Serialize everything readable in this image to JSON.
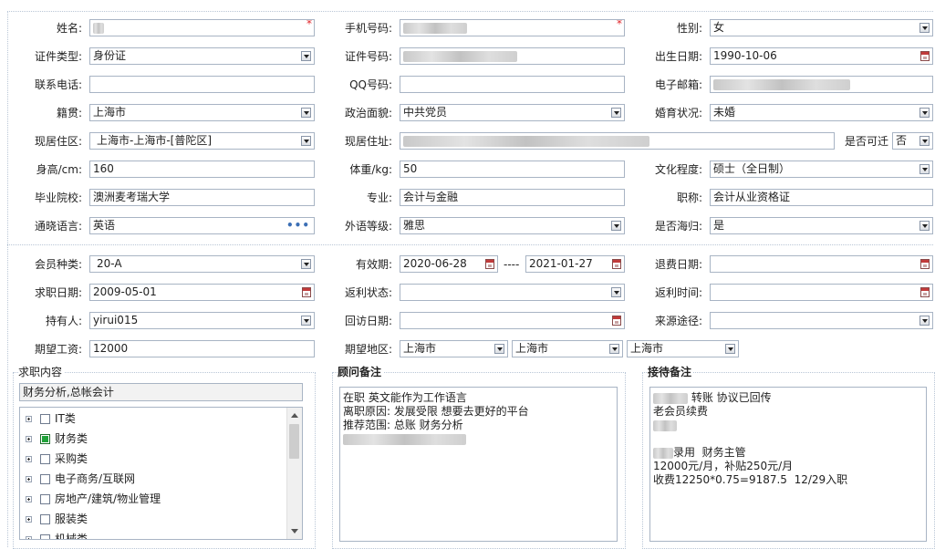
{
  "fields": {
    "name": {
      "label": "姓名:",
      "value": ""
    },
    "mobile": {
      "label": "手机号码:",
      "value": ""
    },
    "gender": {
      "label": "性别:",
      "value": "女"
    },
    "id_type": {
      "label": "证件类型:",
      "value": "身份证"
    },
    "id_number": {
      "label": "证件号码:",
      "value": ""
    },
    "birth_date": {
      "label": "出生日期:",
      "value": "1990-10-06"
    },
    "phone": {
      "label": "联系电话:",
      "value": ""
    },
    "qq": {
      "label": "QQ号码:",
      "value": ""
    },
    "email": {
      "label": "电子邮箱:",
      "value": ""
    },
    "native_place": {
      "label": "籍贯:",
      "value": "上海市"
    },
    "political": {
      "label": "政治面貌:",
      "value": "中共党员"
    },
    "marital": {
      "label": "婚育状况:",
      "value": "未婚"
    },
    "residence_area": {
      "label": "现居住区:",
      "value": "上海市-上海市-[普陀区]"
    },
    "address": {
      "label": "现居住址:",
      "value": ""
    },
    "relocate": {
      "label": "是否可迁",
      "value": "否"
    },
    "height": {
      "label": "身高/cm:",
      "value": "160"
    },
    "weight": {
      "label": "体重/kg:",
      "value": "50"
    },
    "education": {
      "label": "文化程度:",
      "value": "硕士（全日制）"
    },
    "school": {
      "label": "毕业院校:",
      "value": "澳洲麦考瑞大学"
    },
    "major": {
      "label": "专业:",
      "value": "会计与金融"
    },
    "title": {
      "label": "职称:",
      "value": "会计从业资格证"
    },
    "language": {
      "label": "通晓语言:",
      "value": "英语"
    },
    "language_level": {
      "label": "外语等级:",
      "value": "雅思"
    },
    "overseas": {
      "label": "是否海归:",
      "value": "是"
    }
  },
  "membership": {
    "type": {
      "label": "会员种类:",
      "value": "20-A"
    },
    "valid": {
      "label": "有效期:",
      "from": "2020-06-28",
      "sep": "----",
      "to": "2021-01-27"
    },
    "refund_date": {
      "label": "退费日期:",
      "value": ""
    },
    "job_date": {
      "label": "求职日期:",
      "value": "2009-05-01"
    },
    "rebate_status": {
      "label": "返利状态:",
      "value": ""
    },
    "rebate_time": {
      "label": "返利时间:",
      "value": ""
    },
    "holder": {
      "label": "持有人:",
      "value": "yirui015"
    },
    "visit_date": {
      "label": "回访日期:",
      "value": ""
    },
    "source": {
      "label": "来源途径:",
      "value": ""
    },
    "salary": {
      "label": "期望工资:",
      "value": "12000"
    },
    "region": {
      "label": "期望地区:",
      "values": [
        "上海市",
        "上海市",
        "上海市"
      ]
    }
  },
  "job_content": {
    "title": "求职内容",
    "summary": "财务分析,总帐会计",
    "items": [
      {
        "label": "IT类",
        "checked": false
      },
      {
        "label": "财务类",
        "checked": true
      },
      {
        "label": "采购类",
        "checked": false
      },
      {
        "label": "电子商务/互联网",
        "checked": false
      },
      {
        "label": "房地产/建筑/物业管理",
        "checked": false
      },
      {
        "label": "服装类",
        "checked": false
      },
      {
        "label": "机械类",
        "checked": false
      }
    ]
  },
  "advisor_notes": {
    "title": "顾问备注",
    "lines": [
      "在职 英文能作为工作语言",
      "离职原因: 发展受限 想要去更好的平台",
      "推荐范围: 总账 财务分析"
    ]
  },
  "reception_notes": {
    "title": "接待备注",
    "lines": [
      "转账 协议已回传",
      "老会员续费",
      "",
      "",
      "录用  财务主管",
      "12000元/月，补贴250元/月",
      "收费12250*0.75=9187.5  12/29入职"
    ]
  },
  "colors": {
    "required": "#e0262b",
    "checked": "#21a33a",
    "border": "#a8b4c4",
    "link": "#3c6fb5"
  }
}
